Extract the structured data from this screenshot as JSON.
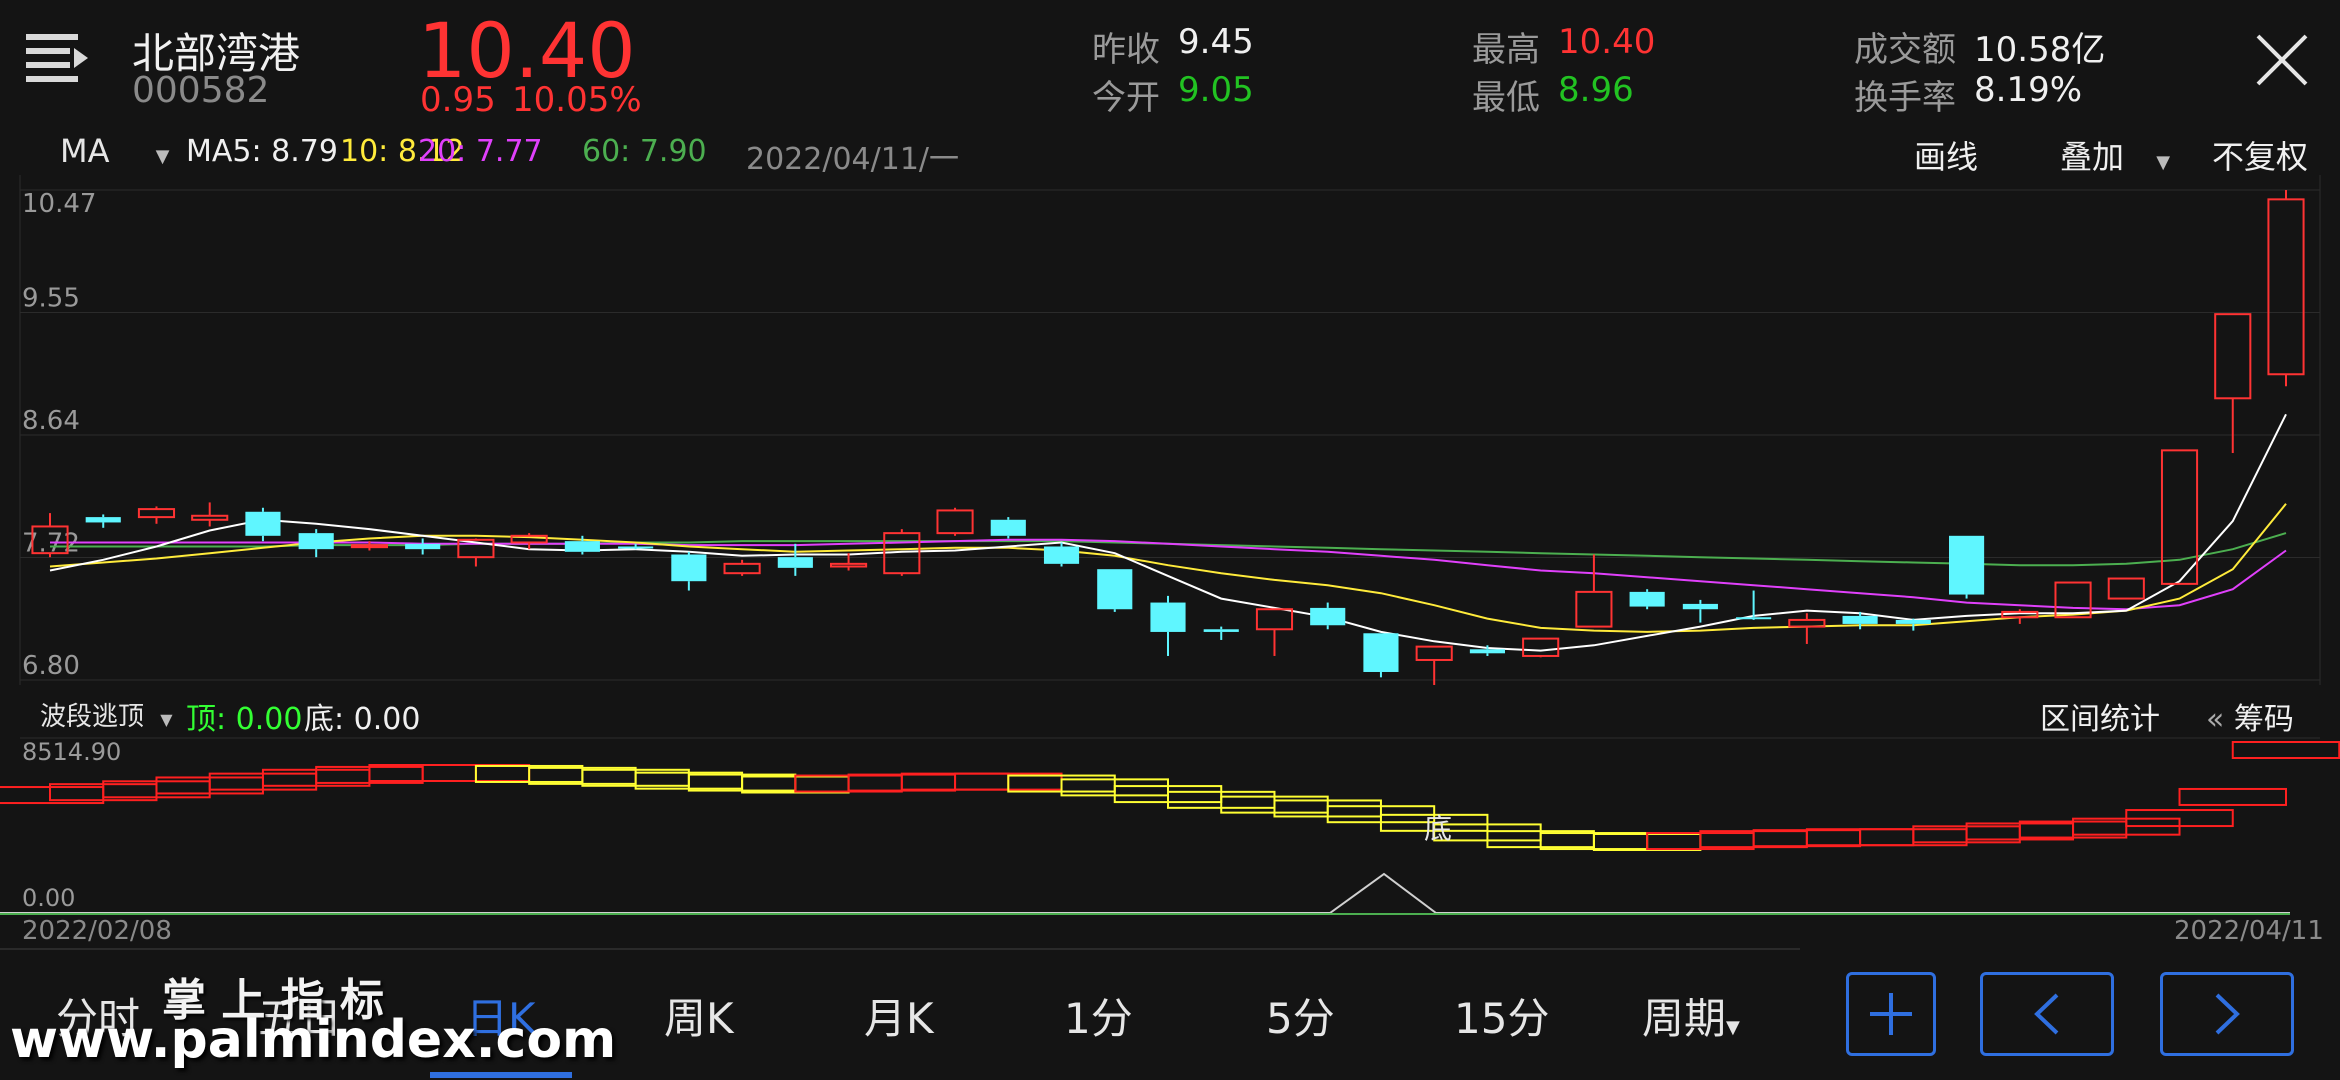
{
  "stock": {
    "name": "北部湾港",
    "code": "000582",
    "price": "10.40",
    "change": "0.95",
    "change_pct": "10.05%",
    "prev_close_label": "昨收",
    "prev_close": "9.45",
    "open_label": "今开",
    "open": "9.05",
    "high_label": "最高",
    "high": "10.40",
    "low_label": "最低",
    "low": "8.96",
    "turnover_label": "成交额",
    "turnover": "10.58亿",
    "turnover_rate_label": "换手率",
    "turnover_rate": "8.19%"
  },
  "indicator_bar": {
    "ma_select": "MA",
    "ma5": "MA5: 8.79",
    "ma10": "10: 8.12",
    "ma20": "20: 7.77",
    "ma60": "60: 7.90",
    "date": "2022/04/11/一",
    "draw_line": "画线",
    "overlay": "叠加",
    "adjust": "不复权"
  },
  "main_axis": [
    "10.47",
    "9.55",
    "8.64",
    "7.72",
    "6.80"
  ],
  "sub_indicator": {
    "name": "波段逃顶",
    "top": "顶: 0.00",
    "bottom": "底: 0.00",
    "range_stats": "区间统计",
    "chips": "筹码",
    "axis_max": "8514.90",
    "axis_min": "0.00",
    "marker": "底"
  },
  "dates": {
    "start": "2022/02/08",
    "end": "2022/04/11"
  },
  "tabs": [
    "分时",
    "五日",
    "日K",
    "周K",
    "月K",
    "1分",
    "5分",
    "15分",
    "周期"
  ],
  "active_tab": "日K",
  "watermark": {
    "cn": "掌 上 指 标",
    "url": "www.palmindex.com"
  },
  "colors": {
    "up": "#ff3333",
    "down": "#5ff6ff",
    "ma5": "#ffffff",
    "ma10": "#ffeb3b",
    "ma20": "#e040fb",
    "ma60": "#4caf50",
    "accent": "#2f6fe0"
  },
  "chart_data": {
    "type": "candlestick",
    "y_range": [
      6.8,
      10.47
    ],
    "candles": [
      {
        "o": 7.75,
        "h": 8.05,
        "l": 7.72,
        "c": 7.95
      },
      {
        "o": 8.02,
        "h": 8.04,
        "l": 7.94,
        "c": 7.98
      },
      {
        "o": 8.02,
        "h": 8.1,
        "l": 7.97,
        "c": 8.08
      },
      {
        "o": 8.0,
        "h": 8.13,
        "l": 7.95,
        "c": 8.03
      },
      {
        "o": 8.06,
        "h": 8.09,
        "l": 7.84,
        "c": 7.88
      },
      {
        "o": 7.9,
        "h": 7.93,
        "l": 7.72,
        "c": 7.78
      },
      {
        "o": 7.8,
        "h": 7.84,
        "l": 7.77,
        "c": 7.81
      },
      {
        "o": 7.82,
        "h": 7.86,
        "l": 7.74,
        "c": 7.78
      },
      {
        "o": 7.72,
        "h": 7.86,
        "l": 7.65,
        "c": 7.85
      },
      {
        "o": 7.83,
        "h": 7.9,
        "l": 7.78,
        "c": 7.88
      },
      {
        "o": 7.84,
        "h": 7.88,
        "l": 7.74,
        "c": 7.76
      },
      {
        "o": 7.8,
        "h": 7.82,
        "l": 7.78,
        "c": 7.79
      },
      {
        "o": 7.74,
        "h": 7.76,
        "l": 7.47,
        "c": 7.54
      },
      {
        "o": 7.6,
        "h": 7.7,
        "l": 7.58,
        "c": 7.67
      },
      {
        "o": 7.72,
        "h": 7.82,
        "l": 7.58,
        "c": 7.64
      },
      {
        "o": 7.65,
        "h": 7.75,
        "l": 7.62,
        "c": 7.67
      },
      {
        "o": 7.6,
        "h": 7.93,
        "l": 7.58,
        "c": 7.9
      },
      {
        "o": 7.9,
        "h": 8.09,
        "l": 7.88,
        "c": 8.07
      },
      {
        "o": 8.0,
        "h": 8.02,
        "l": 7.86,
        "c": 7.88
      },
      {
        "o": 7.8,
        "h": 7.83,
        "l": 7.65,
        "c": 7.67
      },
      {
        "o": 7.63,
        "h": 7.63,
        "l": 7.31,
        "c": 7.33
      },
      {
        "o": 7.38,
        "h": 7.43,
        "l": 6.98,
        "c": 7.16
      },
      {
        "o": 7.18,
        "h": 7.2,
        "l": 7.1,
        "c": 7.16
      },
      {
        "o": 7.18,
        "h": 7.33,
        "l": 6.98,
        "c": 7.33
      },
      {
        "o": 7.34,
        "h": 7.38,
        "l": 7.18,
        "c": 7.21
      },
      {
        "o": 7.15,
        "h": 7.15,
        "l": 6.82,
        "c": 6.86
      },
      {
        "o": 6.95,
        "h": 7.05,
        "l": 6.75,
        "c": 7.05
      },
      {
        "o": 7.03,
        "h": 7.06,
        "l": 6.98,
        "c": 7.0
      },
      {
        "o": 6.98,
        "h": 7.11,
        "l": 6.97,
        "c": 7.11
      },
      {
        "o": 7.2,
        "h": 7.74,
        "l": 7.2,
        "c": 7.46
      },
      {
        "o": 7.46,
        "h": 7.48,
        "l": 7.33,
        "c": 7.35
      },
      {
        "o": 7.37,
        "h": 7.4,
        "l": 7.23,
        "c": 7.33
      },
      {
        "o": 7.27,
        "h": 7.47,
        "l": 7.25,
        "c": 7.26
      },
      {
        "o": 7.2,
        "h": 7.3,
        "l": 7.07,
        "c": 7.25
      },
      {
        "o": 7.28,
        "h": 7.31,
        "l": 7.18,
        "c": 7.22
      },
      {
        "o": 7.25,
        "h": 7.26,
        "l": 7.17,
        "c": 7.22
      },
      {
        "o": 7.88,
        "h": 7.88,
        "l": 7.41,
        "c": 7.44
      },
      {
        "o": 7.27,
        "h": 7.33,
        "l": 7.22,
        "c": 7.31
      },
      {
        "o": 7.27,
        "h": 7.53,
        "l": 7.27,
        "c": 7.53
      },
      {
        "o": 7.41,
        "h": 7.56,
        "l": 7.41,
        "c": 7.56
      },
      {
        "o": 7.52,
        "h": 8.52,
        "l": 7.52,
        "c": 8.52
      },
      {
        "o": 8.91,
        "h": 9.54,
        "l": 8.5,
        "c": 9.54
      },
      {
        "o": 9.09,
        "h": 10.47,
        "l": 9.0,
        "c": 10.4
      }
    ],
    "ma5": [
      7.62,
      7.7,
      7.8,
      7.92,
      8.0,
      7.97,
      7.93,
      7.88,
      7.83,
      7.78,
      7.77,
      7.78,
      7.76,
      7.73,
      7.74,
      7.74,
      7.76,
      7.77,
      7.8,
      7.83,
      7.75,
      7.58,
      7.41,
      7.34,
      7.27,
      7.16,
      7.09,
      7.04,
      7.02,
      7.06,
      7.13,
      7.2,
      7.28,
      7.32,
      7.3,
      7.25,
      7.28,
      7.3,
      7.3,
      7.32,
      7.54,
      7.99,
      8.79
    ],
    "ma10": [
      7.65,
      7.68,
      7.71,
      7.75,
      7.79,
      7.83,
      7.86,
      7.88,
      7.88,
      7.87,
      7.85,
      7.83,
      7.8,
      7.78,
      7.76,
      7.77,
      7.78,
      7.79,
      7.79,
      7.77,
      7.73,
      7.66,
      7.6,
      7.55,
      7.51,
      7.45,
      7.36,
      7.26,
      7.19,
      7.17,
      7.16,
      7.17,
      7.19,
      7.2,
      7.21,
      7.21,
      7.24,
      7.27,
      7.29,
      7.32,
      7.41,
      7.63,
      8.12
    ],
    "ma20": [
      7.83,
      7.83,
      7.83,
      7.83,
      7.83,
      7.83,
      7.83,
      7.82,
      7.82,
      7.82,
      7.82,
      7.82,
      7.81,
      7.81,
      7.81,
      7.82,
      7.83,
      7.84,
      7.85,
      7.85,
      7.84,
      7.82,
      7.8,
      7.78,
      7.76,
      7.73,
      7.7,
      7.66,
      7.62,
      7.6,
      7.57,
      7.54,
      7.51,
      7.48,
      7.45,
      7.42,
      7.38,
      7.36,
      7.34,
      7.33,
      7.36,
      7.48,
      7.77
    ],
    "ma60": [
      7.8,
      7.8,
      7.8,
      7.8,
      7.8,
      7.81,
      7.81,
      7.81,
      7.82,
      7.82,
      7.82,
      7.83,
      7.83,
      7.84,
      7.84,
      7.84,
      7.84,
      7.84,
      7.84,
      7.84,
      7.83,
      7.82,
      7.81,
      7.8,
      7.79,
      7.78,
      7.77,
      7.76,
      7.75,
      7.74,
      7.73,
      7.72,
      7.71,
      7.7,
      7.69,
      7.68,
      7.67,
      7.66,
      7.66,
      7.67,
      7.7,
      7.78,
      7.9
    ]
  }
}
